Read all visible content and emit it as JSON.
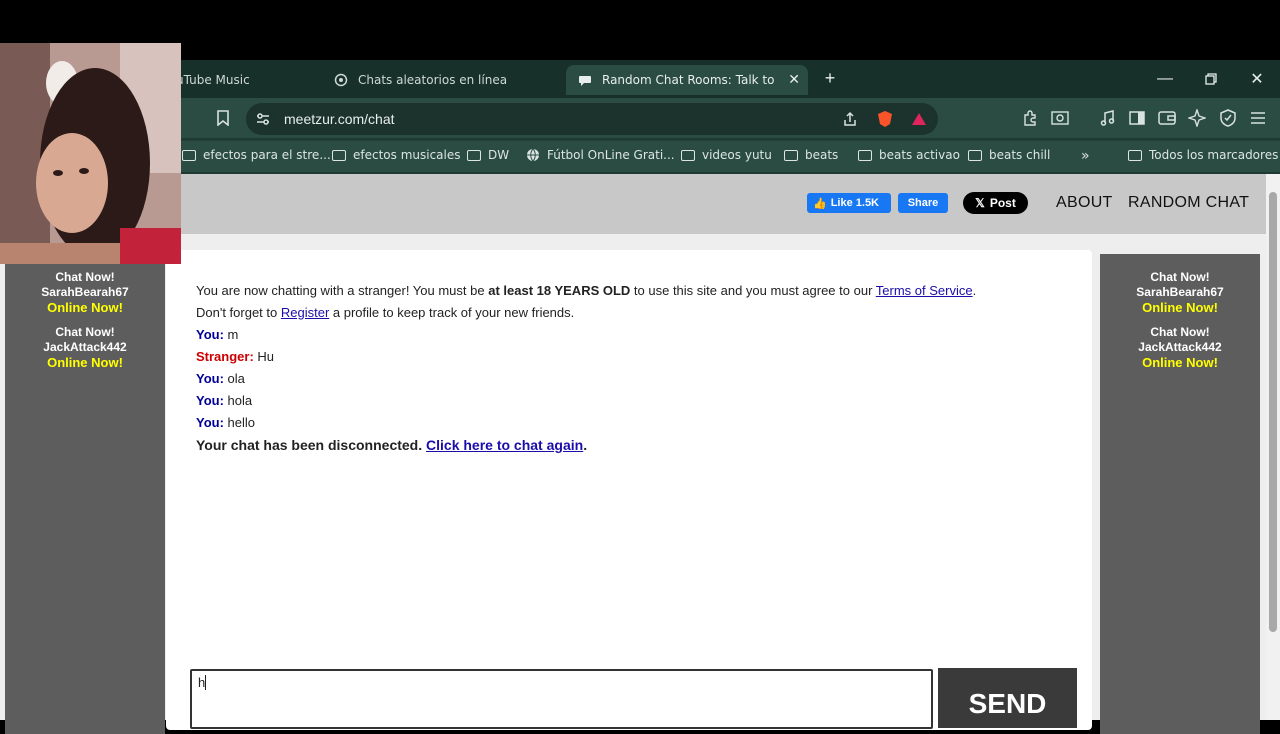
{
  "tabs": [
    {
      "label": "uTube Music"
    },
    {
      "label": "Chats aleatorios en línea"
    },
    {
      "label": "Random Chat Rooms: Talk to Str"
    }
  ],
  "address": {
    "url": "meetzur.com/chat"
  },
  "bookmarks": [
    {
      "label": "efectos para el stre..."
    },
    {
      "label": "efectos musicales"
    },
    {
      "label": "DW"
    },
    {
      "label": "Fútbol OnLine Grati..."
    },
    {
      "label": "videos yutu"
    },
    {
      "label": "beats"
    },
    {
      "label": "beats activao"
    },
    {
      "label": "beats chill"
    },
    {
      "label": "Todos los marcadores"
    }
  ],
  "header": {
    "fb_like": "Like 1.5K",
    "fb_share": "Share",
    "x_post": "Post",
    "about": "ABOUT",
    "random_chat": "RANDOM CHAT"
  },
  "sidebar": {
    "promos": [
      {
        "title": "Chat Now!",
        "user": "SarahBearah67",
        "status": "Online Now!"
      },
      {
        "title": "Chat Now!",
        "user": "JackAttack442",
        "status": "Online Now!"
      }
    ]
  },
  "chat": {
    "intro_1": "You are now chatting with a stranger! You must be ",
    "intro_bold": "at least 18 YEARS OLD",
    "intro_2": " to use this site and you must agree to our ",
    "tos_link": "Terms of Service",
    "intro_3": ".",
    "register_1": "Don't forget to ",
    "register_link": "Register",
    "register_2": " a profile to keep track of your new friends.",
    "messages": [
      {
        "who": "You:",
        "text": "m"
      },
      {
        "who": "Stranger:",
        "text": "Hu"
      },
      {
        "who": "You:",
        "text": "ola"
      },
      {
        "who": "You:",
        "text": "hola"
      },
      {
        "who": "You:",
        "text": "hello"
      }
    ],
    "disconnected": "Your chat has been disconnected. ",
    "again_link": "Click here to chat again",
    "again_end": "."
  },
  "composer": {
    "value": "h",
    "send_label": "SEND"
  }
}
